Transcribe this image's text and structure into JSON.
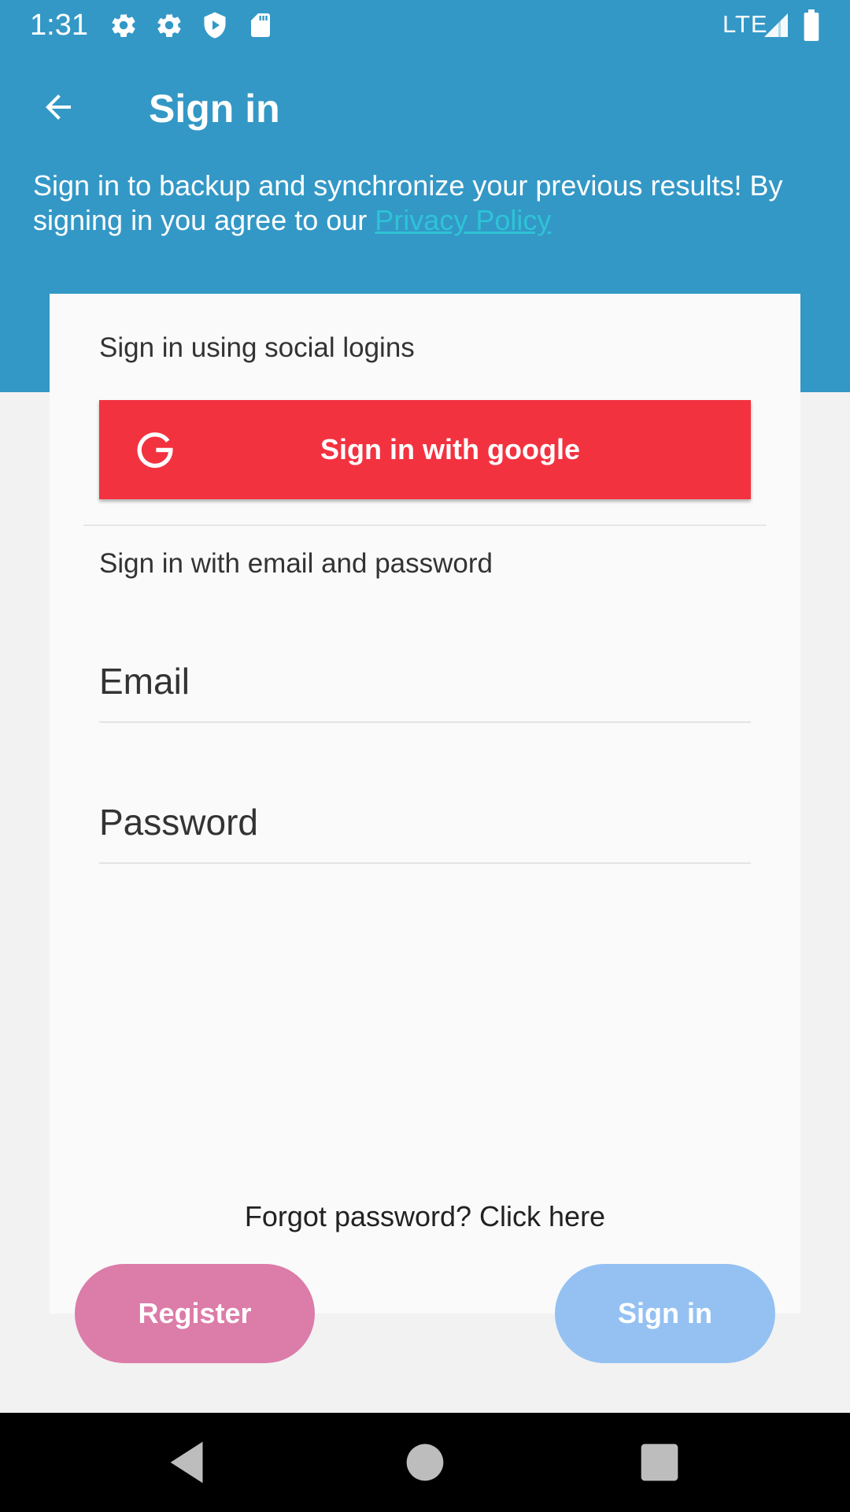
{
  "status_bar": {
    "time": "1:31",
    "network": "LTE",
    "icons": [
      "settings-icon",
      "settings-icon",
      "shield-icon",
      "sd-card-icon",
      "signal-icon",
      "battery-icon"
    ]
  },
  "app_bar": {
    "title": "Sign in",
    "back_icon": "arrow-back-icon"
  },
  "intro": {
    "text": "Sign in to backup and synchronize your previous results! By signing in you agree to our ",
    "privacy_link": "Privacy Policy"
  },
  "social": {
    "heading": "Sign in using social logins",
    "google_button": "Sign in with google"
  },
  "email_section": {
    "heading": "Sign in with email and password",
    "email_placeholder": "Email",
    "password_placeholder": "Password"
  },
  "forgot": "Forgot password? Click here",
  "buttons": {
    "register": "Register",
    "sign_in": "Sign in"
  },
  "colors": {
    "header": "#3398c6",
    "google": "#f33240",
    "register": "#dc7ca8",
    "sign_in": "#94c1f2",
    "link": "#2ec3d6"
  }
}
